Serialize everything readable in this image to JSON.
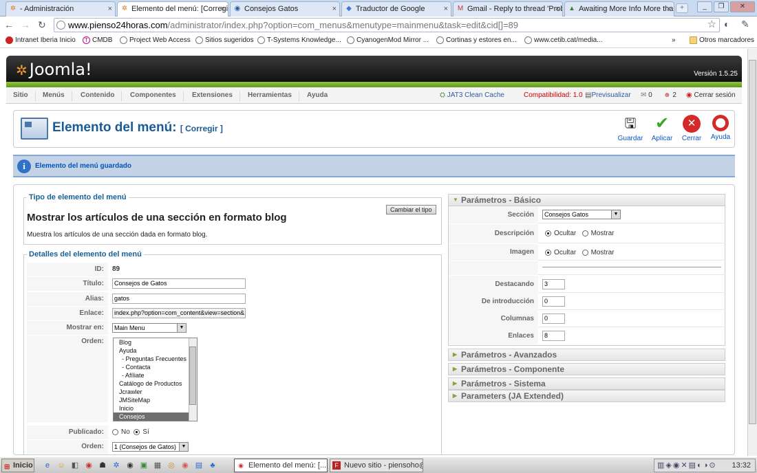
{
  "browser": {
    "tabs": [
      {
        "label": "- Administración",
        "icon": "joomla-icon"
      },
      {
        "label": "Elemento del menú: [Corregir",
        "icon": "joomla-icon"
      },
      {
        "label": "Consejos Gatos",
        "icon": "globe-icon"
      },
      {
        "label": "Traductor de Google",
        "icon": "google-translate-icon"
      },
      {
        "label": "Gmail - Reply to thread 'Probl",
        "icon": "gmail-icon"
      },
      {
        "label": "Awaiting More Info More tha",
        "icon": "forum-icon"
      }
    ],
    "url_host": "www.pienso24horas.com",
    "url_rest": "/administrator/index.php?option=com_menus&menutype=mainmenu&task=edit&cid[]=89",
    "bookmarks": [
      "Intranet Iberia Inicio",
      "CMDB",
      "Project Web Access",
      "Sitios sugeridos",
      "T-Systems Knowledge...",
      "CyanogenMod Mirror ...",
      "Cortinas y estores en...",
      "www.cetib.cat/media..."
    ],
    "bookmarks_overflow": "»",
    "other_bookmarks": "Otros marcadores"
  },
  "joomla": {
    "logo": "Joomla!",
    "version": "Versión 1.5.25",
    "menu": [
      "Sitio",
      "Menús",
      "Contenido",
      "Componentes",
      "Extensiones",
      "Herramientas",
      "Ayuda"
    ],
    "right": {
      "cache": "JAT3 Clean Cache",
      "compat": "Compatibilidad: 1.0",
      "preview": "Previsualizar",
      "msgs": "0",
      "users": "2",
      "logout": "Cerrar sesión"
    },
    "page_title": "Elemento del menú:",
    "page_subtitle": "[ Corregir ]",
    "toolbar": {
      "save": "Guardar",
      "apply": "Aplicar",
      "close": "Cerrar",
      "help": "Ayuda"
    },
    "message": "Elemento del menú guardado"
  },
  "type_fieldset": {
    "legend": "Tipo de elemento del menú",
    "change_btn": "Cambiar el tipo",
    "heading": "Mostrar los artículos de una sección en formato blog",
    "desc": "Muestra los artículos de una sección dada en formato blog."
  },
  "details": {
    "legend": "Detalles del elemento del menú",
    "id_label": "ID:",
    "id_value": "89",
    "title_label": "Título:",
    "title_value": "Consejos de Gatos",
    "alias_label": "Alias:",
    "alias_value": "gatos",
    "link_label": "Enlace:",
    "link_value": "index.php?option=com_content&view=section&",
    "showin_label": "Mostrar en:",
    "showin_value": "Main Menu",
    "order_label": "Orden:",
    "order_items": [
      "Blog",
      "Ayuda",
      "- Preguntas Frecuentes",
      "- Contacta",
      "- Afíliate",
      "Catálogo de Productos",
      "Jcrawler",
      "JMSiteMap",
      "Inicio",
      "Consejos"
    ],
    "published_label": "Publicado:",
    "published_no": "No",
    "published_yes": "Sí",
    "order2_label": "Orden:",
    "order2_value": "1 (Consejos de Gatos)"
  },
  "params": {
    "basic_header": "Parámetros - Básico",
    "section_label": "Sección",
    "section_value": "Consejos Gatos",
    "desc_label": "Descripción",
    "image_label": "Imagen",
    "hide": "Ocultar",
    "show": "Mostrar",
    "featured_label": "Destacando",
    "featured_value": "3",
    "intro_label": "De introducción",
    "intro_value": "0",
    "columns_label": "Columnas",
    "columns_value": "0",
    "links_label": "Enlaces",
    "links_value": "8",
    "collapsed": [
      "Parámetros - Avanzados",
      "Parámetros - Componente",
      "Parámetros - Sistema",
      "Parameters (JA Extended)"
    ]
  },
  "taskbar": {
    "start": "Inicio",
    "tasks": [
      "Elemento del menú: [...",
      "Nuevo sitio - piensoho@..."
    ],
    "clock": "13:32"
  }
}
